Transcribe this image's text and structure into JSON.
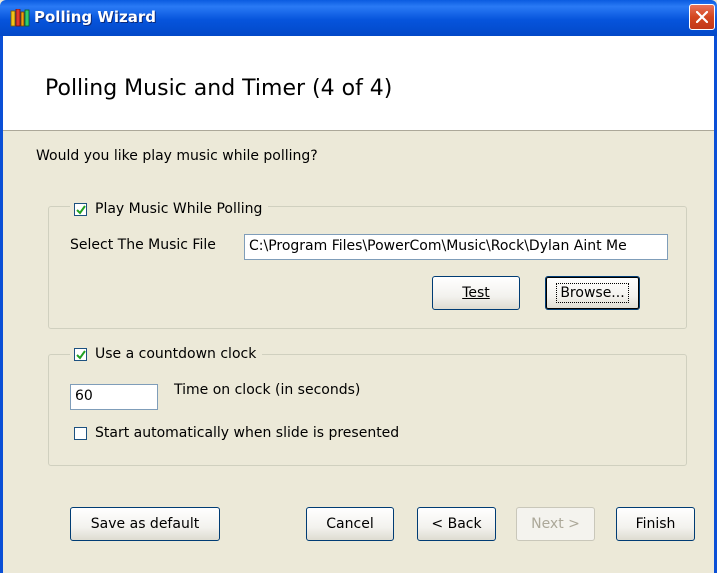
{
  "window": {
    "title": "Polling Wizard",
    "icon": "books-icon",
    "title_color": "#0654dc"
  },
  "header": {
    "title": "Polling Music and Timer (4 of 4)"
  },
  "question": "Would you like play music while polling?",
  "music_group": {
    "checkbox_label": "Play Music While Polling",
    "checked": true,
    "file_label": "Select The Music File",
    "file_value": "C:\\Program Files\\PowerCom\\Music\\Rock\\Dylan Aint Me",
    "test_label": "Test",
    "browse_label": "Browse..."
  },
  "timer_group": {
    "checkbox_label": "Use a countdown clock",
    "checked": true,
    "seconds_value": "60",
    "seconds_label": "Time on clock (in seconds)",
    "auto_start_label": "Start automatically when slide is presented",
    "auto_start_checked": false
  },
  "footer": {
    "save_default_label": "Save as default",
    "cancel_label": "Cancel",
    "back_label": "< Back",
    "next_label": "Next >",
    "next_enabled": false,
    "finish_label": "Finish"
  }
}
